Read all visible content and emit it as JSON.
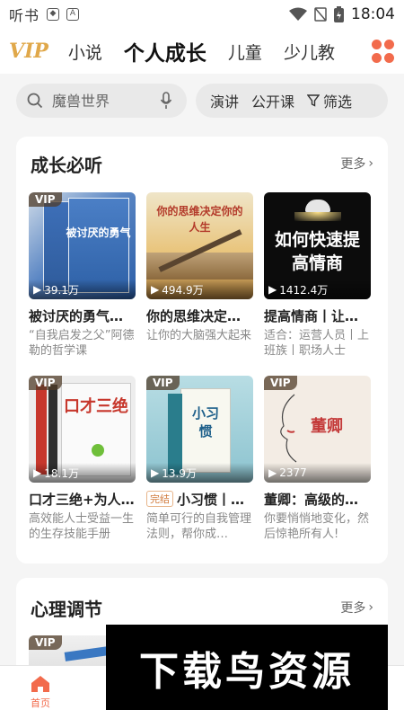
{
  "status_bar": {
    "app_chars": "听书",
    "time": "18:04",
    "icons": [
      "shield-icon",
      "a-icon",
      "wifi-icon",
      "no-sim-icon",
      "battery-icon"
    ]
  },
  "top_nav": {
    "logo": "VIP",
    "tabs": [
      {
        "label": "小说",
        "active": false
      },
      {
        "label": "个人成长",
        "active": true
      },
      {
        "label": "儿童",
        "active": false
      },
      {
        "label": "少儿教",
        "active": false
      }
    ]
  },
  "search": {
    "placeholder": "魔兽世界",
    "quick_tags": [
      "演讲",
      "公开课"
    ],
    "filter_label": "筛选"
  },
  "section1": {
    "title": "成长必听",
    "more": "更多",
    "books": [
      {
        "title": "被讨厌的勇气…",
        "desc": "“自我启发之父”阿德勒的哲学课",
        "plays": "39.1万",
        "vip": true,
        "cover_text": "被讨厌的勇气",
        "finished": false
      },
      {
        "title": "你的思维决定…",
        "desc": "让你的大脑强大起来",
        "plays": "494.9万",
        "vip": false,
        "cover_text": "你的思维决定你的人生",
        "finished": false
      },
      {
        "title": "提高情商丨让…",
        "desc": "适合：运营人员丨上班族丨职场人士",
        "plays": "1412.4万",
        "vip": false,
        "cover_text": "如何快速提高情商",
        "finished": false
      },
      {
        "title": "口才三绝+为人…",
        "desc": "高效能人士受益一生的生存技能手册",
        "plays": "18.1万",
        "vip": true,
        "cover_text": "口才三绝",
        "finished": false
      },
      {
        "title": "小习惯丨…",
        "desc": "简单可行的自我管理法则，帮你成…",
        "plays": "13.9万",
        "vip": true,
        "cover_text": "小习惯",
        "finished": true,
        "finished_label": "完结"
      },
      {
        "title": "董卿：高级的…",
        "desc": "你要悄悄地变化，然后惊艳所有人!",
        "plays": "2377",
        "vip": true,
        "cover_text": "董卿",
        "finished": false
      }
    ]
  },
  "section2": {
    "title": "心理调节",
    "more": "更多"
  },
  "bottom_nav": [
    {
      "label": "首页",
      "active": true
    },
    {
      "label": "",
      "active": false
    },
    {
      "label": "",
      "active": false
    },
    {
      "label": "",
      "active": false
    },
    {
      "label": "",
      "active": false
    }
  ],
  "watermark": "下载鸟资源",
  "colors": {
    "accent": "#f26b4c",
    "vip_gold": "#e0a84a"
  }
}
